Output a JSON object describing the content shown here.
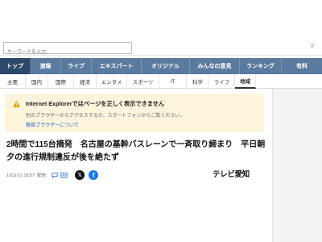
{
  "search": {
    "placeholder": "キーワードを入力"
  },
  "header": {
    "edge_text": "マ"
  },
  "main_nav": {
    "tabs": [
      {
        "label": "トップ",
        "active": true
      },
      {
        "label": "速報",
        "active": false
      },
      {
        "label": "ライブ",
        "active": false
      },
      {
        "label": "エキスパート",
        "active": false
      },
      {
        "label": "オリジナル",
        "active": false
      },
      {
        "label": "みんなの意見",
        "active": false
      },
      {
        "label": "ランキング",
        "active": false
      },
      {
        "label": "有料",
        "active": false
      }
    ]
  },
  "sub_nav": {
    "items": [
      {
        "label": "主要",
        "active": false
      },
      {
        "label": "国内",
        "active": false
      },
      {
        "label": "国際",
        "active": false
      },
      {
        "label": "経済",
        "active": false
      },
      {
        "label": "エンタメ",
        "active": false
      },
      {
        "label": "スポーツ",
        "active": false
      },
      {
        "label": "IT",
        "active": false
      },
      {
        "label": "科学",
        "active": false
      },
      {
        "label": "ライフ",
        "active": false
      },
      {
        "label": "地域",
        "active": true
      }
    ]
  },
  "notice": {
    "title": "Internet Explorerではページを正しく表示できません",
    "body": "別のブラウザーからアクセスするか、スマートフォンからご覧ください。",
    "link": "推奨ブラウザーについて",
    "icon": "warning-icon"
  },
  "article": {
    "headline": "2時間で115台摘発　名古屋の基幹バスレーンで一斉取り締まり　平日朝夕の進行規制違反が後を絶たず",
    "datetime": "1/21(火) 18:57",
    "delivered": "配信",
    "comment_count": "569",
    "source": "テレビ愛知"
  },
  "colors": {
    "nav_bg": "#5a7a9f",
    "nav_active": "#2d4868",
    "notice_bg": "#fdf4dc",
    "link": "#1a66c4",
    "warning": "#e6a100"
  }
}
